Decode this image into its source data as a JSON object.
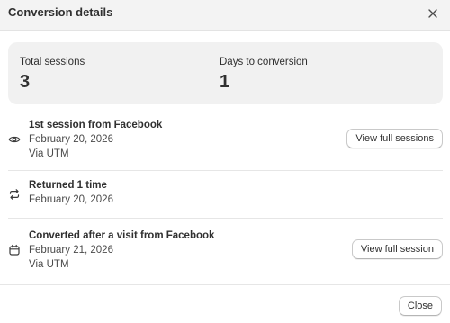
{
  "dialog": {
    "title": "Conversion details",
    "close_icon": "close-icon"
  },
  "summary": {
    "total_sessions_label": "Total sessions",
    "total_sessions_value": "3",
    "days_to_conversion_label": "Days to conversion",
    "days_to_conversion_value": "1"
  },
  "timeline": [
    {
      "icon": "eye-icon",
      "title": "1st session from Facebook",
      "date": "February 20, 2026",
      "source": "Via UTM",
      "button_label": "View full sessions"
    },
    {
      "icon": "repeat-icon",
      "title": "Returned 1 time",
      "date": "February 20, 2026"
    },
    {
      "icon": "calendar-icon",
      "title": "Converted after a visit from Facebook",
      "date": "February 21, 2026",
      "source": "Via UTM",
      "button_label": "View full session"
    }
  ],
  "footer": {
    "close_label": "Close"
  },
  "colors": {
    "header_bg": "#f3f3f3",
    "summary_bg": "#f1f1f1",
    "text": "#303030",
    "divider": "#e6e6e6"
  }
}
